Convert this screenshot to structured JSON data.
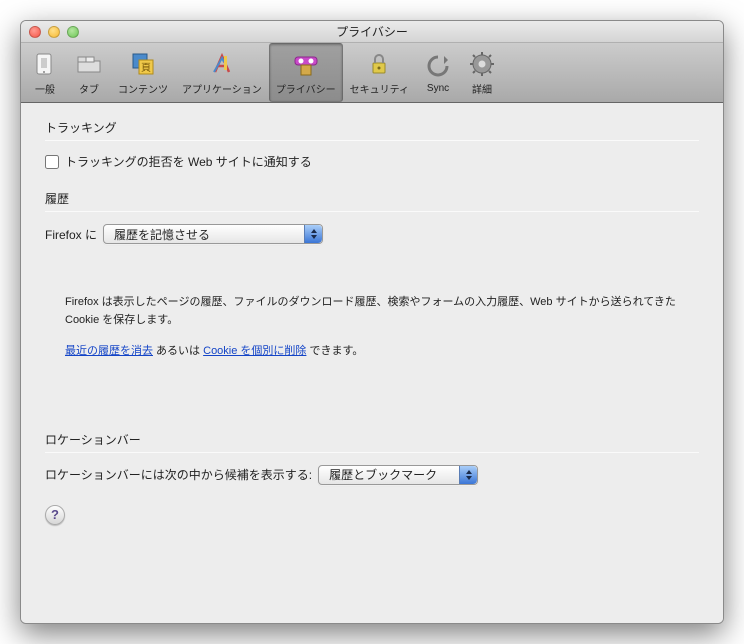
{
  "window": {
    "title": "プライバシー"
  },
  "toolbar": {
    "items": [
      {
        "label": "一般",
        "icon": "general"
      },
      {
        "label": "タブ",
        "icon": "tabs"
      },
      {
        "label": "コンテンツ",
        "icon": "content"
      },
      {
        "label": "アプリケーション",
        "icon": "applications"
      },
      {
        "label": "プライバシー",
        "icon": "privacy",
        "selected": true
      },
      {
        "label": "セキュリティ",
        "icon": "security"
      },
      {
        "label": "Sync",
        "icon": "sync"
      },
      {
        "label": "詳細",
        "icon": "advanced"
      }
    ]
  },
  "sections": {
    "tracking": {
      "title": "トラッキング",
      "checkbox_label": "トラッキングの拒否を Web サイトに通知する",
      "checked": false
    },
    "history": {
      "title": "履歴",
      "prefix_label": "Firefox に",
      "dropdown_value": "履歴を記憶させる",
      "description": "Firefox は表示したページの履歴、ファイルのダウンロード履歴、検索やフォームの入力履歴、Web サイトから送られてきた Cookie を保存します。",
      "link1": "最近の履歴を消去",
      "middle_text": " あるいは ",
      "link2": "Cookie を個別に削除",
      "suffix_text": " できます。"
    },
    "locationbar": {
      "title": "ロケーションバー",
      "label": "ロケーションバーには次の中から候補を表示する:",
      "dropdown_value": "履歴とブックマーク"
    }
  },
  "help_button": "?"
}
